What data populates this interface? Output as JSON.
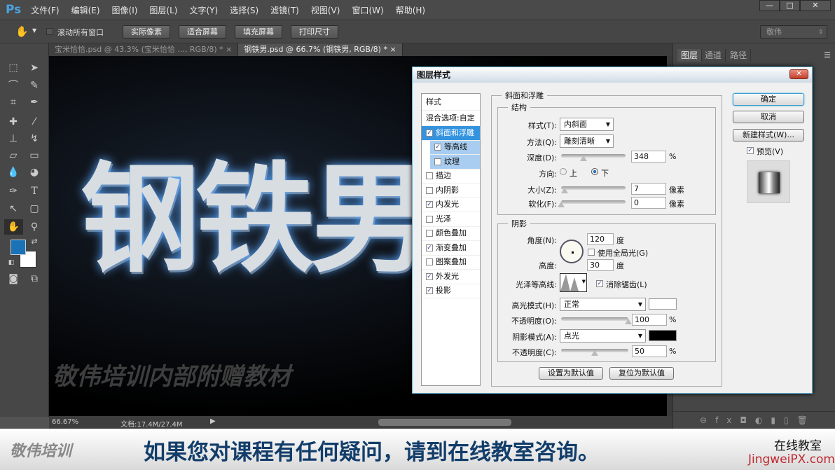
{
  "app": {
    "logo": "Ps",
    "menu": [
      "文件(F)",
      "编辑(E)",
      "图像(I)",
      "图层(L)",
      "文字(Y)",
      "选择(S)",
      "滤镜(T)",
      "视图(V)",
      "窗口(W)",
      "帮助(H)"
    ],
    "window_buttons": [
      "—",
      "□",
      "✕"
    ]
  },
  "options": {
    "scroll_all": "滚动所有窗口",
    "buttons": [
      "实际像素",
      "适合屏幕",
      "填充屏幕",
      "打印尺寸"
    ],
    "workspace": "敬伟"
  },
  "tabs": [
    {
      "label": "宝米恰恰.psd @ 43.3% (宝米恰恰 ..., RGB/8) *",
      "close": "×"
    },
    {
      "label": "钢铁男.psd @ 66.7% (钢铁男, RGB/8) *",
      "close": "×"
    }
  ],
  "canvas": {
    "title_art": "钢铁男",
    "watermark": "敬伟培训内部附赠教材"
  },
  "colors": {
    "foreground": "#1a73b8",
    "background": "#ffffff"
  },
  "status": {
    "zoom": "66.67%",
    "doc": "文档:17.4M/27.4M"
  },
  "right_panel": {
    "tabs": [
      "图层",
      "通道",
      "路径"
    ]
  },
  "dialog": {
    "title": "图层样式",
    "close": "✕",
    "styles_header": "样式",
    "blend_options": "混合选项:自定",
    "styles": [
      {
        "label": "斜面和浮雕",
        "checked": true,
        "selected": true
      },
      {
        "label": "等高线",
        "checked": true,
        "sub": true
      },
      {
        "label": "纹理",
        "checked": false,
        "sub": true
      },
      {
        "label": "描边",
        "checked": false
      },
      {
        "label": "内阴影",
        "checked": false
      },
      {
        "label": "内发光",
        "checked": true
      },
      {
        "label": "光泽",
        "checked": false
      },
      {
        "label": "颜色叠加",
        "checked": false
      },
      {
        "label": "渐变叠加",
        "checked": true
      },
      {
        "label": "图案叠加",
        "checked": false
      },
      {
        "label": "外发光",
        "checked": true
      },
      {
        "label": "投影",
        "checked": true
      }
    ],
    "section": "斜面和浮雕",
    "structure": {
      "legend": "结构",
      "style_label": "样式(T):",
      "style_value": "内斜面",
      "technique_label": "方法(Q):",
      "technique_value": "雕刻清晰",
      "depth_label": "深度(D):",
      "depth": "348",
      "depth_pct": 0.35,
      "percent": "%",
      "direction_label": "方向:",
      "up": "上",
      "down": "下",
      "size_label": "大小(Z):",
      "size": "7",
      "size_pct": 0.05,
      "soften_label": "软化(F):",
      "soften": "0",
      "soften_pct": 0,
      "px": "像素"
    },
    "shading": {
      "legend": "阴影",
      "angle_label": "角度(N):",
      "angle": "120",
      "deg": "度",
      "global_light": "使用全局光(G)",
      "altitude_label": "高度:",
      "altitude": "30",
      "gloss_label": "光泽等高线:",
      "anti_alias": "消除锯齿(L)",
      "highlight_label": "高光模式(H):",
      "highlight_mode": "正常",
      "highlight_color": "#ffffff",
      "hl_opacity_label": "不透明度(O):",
      "hl_opacity": "100",
      "hl_opacity_pct": 1.0,
      "shadow_label": "阴影模式(A):",
      "shadow_mode": "点光",
      "shadow_color": "#000000",
      "sh_opacity_label": "不透明度(C):",
      "sh_opacity": "50",
      "sh_opacity_pct": 0.5
    },
    "make_default": "设置为默认值",
    "reset_default": "复位为默认值",
    "ok": "确定",
    "cancel": "取消",
    "new_style": "新建样式(W)...",
    "preview": "预览(V)"
  },
  "banner": {
    "brand": "敬伟培训",
    "message": "如果您对课程有任何疑问，请到在线教室咨询。",
    "online": "在线教室",
    "site": "JingweiPX.com"
  }
}
